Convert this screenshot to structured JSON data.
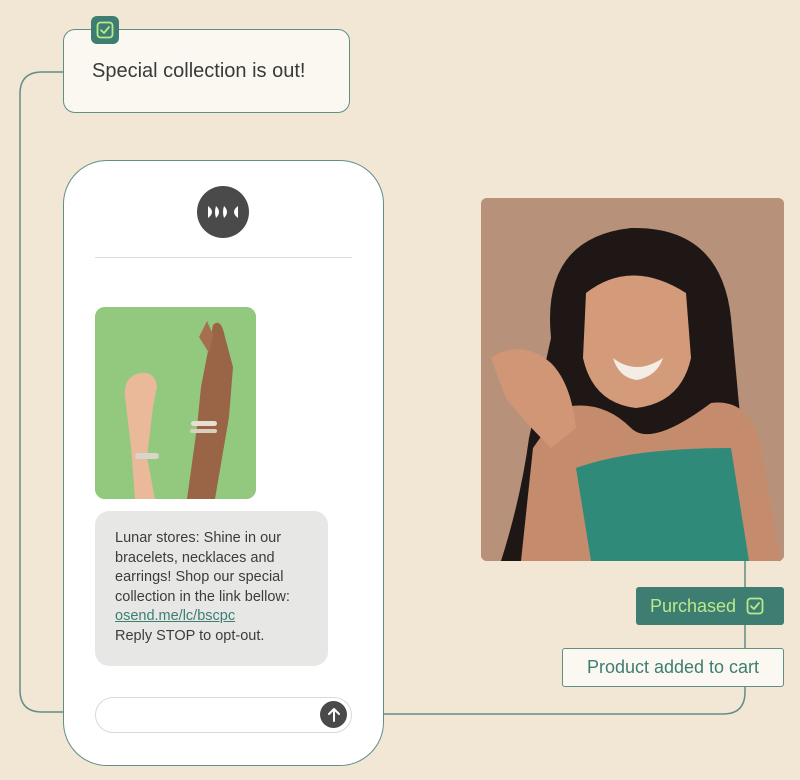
{
  "notification": {
    "text": "Special collection is out!",
    "badge_icon": "check-icon"
  },
  "phone": {
    "logo_icon": "brand-logo-icon",
    "message": {
      "lines": [
        "Lunar stores: Shine in our",
        "bracelets, necklaces and",
        "earrings! Shop our special",
        "collection in the link bellow:"
      ],
      "link": "osend.me/lc/bscpc",
      "opt_out": "Reply STOP to opt-out."
    },
    "send_icon": "arrow-up-icon"
  },
  "tags": {
    "purchased": "Purchased",
    "purchased_icon": "check-icon",
    "cart": "Product added to cart"
  },
  "colors": {
    "background": "#f2e6d5",
    "accent": "#3d7d72",
    "highlight": "#b9ea8a"
  }
}
